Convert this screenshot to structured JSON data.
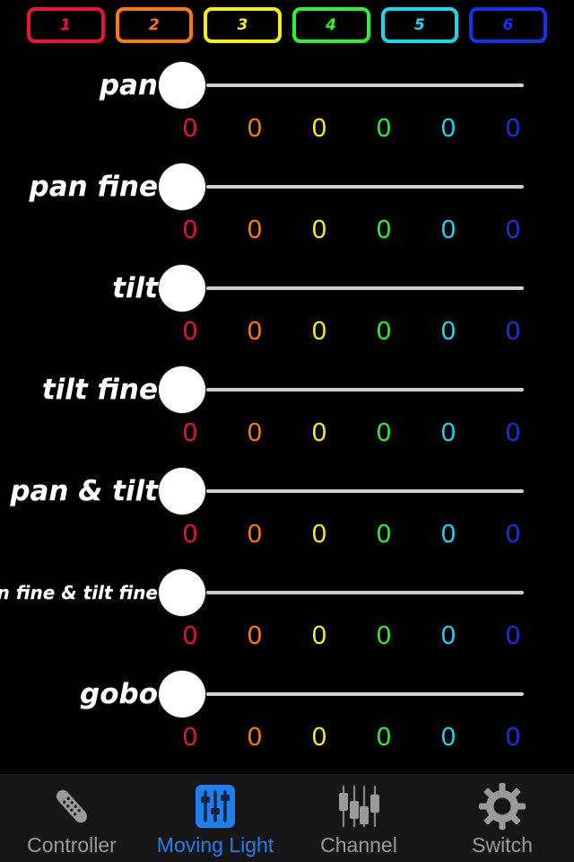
{
  "app": {
    "background": "#000000"
  },
  "channel_bar": {
    "name": "channel-selector",
    "buttons": [
      {
        "label": "1",
        "color": "#ee1133"
      },
      {
        "label": "2",
        "color": "#ff7a00"
      },
      {
        "label": "3",
        "color": "#f8ee14"
      },
      {
        "label": "4",
        "color": "#2bf22b"
      },
      {
        "label": "5",
        "color": "#18d8f0"
      },
      {
        "label": "6",
        "color": "#1432e8"
      }
    ]
  },
  "channel_colors": [
    "#ee1133",
    "#ff7a00",
    "#f8ee14",
    "#2bf22b",
    "#18d8f0",
    "#1432e8"
  ],
  "rows": [
    {
      "label": "pan",
      "label_size": "normal",
      "slider_percent": 0,
      "values": [
        "0",
        "0",
        "0",
        "0",
        "0",
        "0"
      ]
    },
    {
      "label": "pan fine",
      "label_size": "normal",
      "slider_percent": 0,
      "values": [
        "0",
        "0",
        "0",
        "0",
        "0",
        "0"
      ]
    },
    {
      "label": "tilt",
      "label_size": "normal",
      "slider_percent": 0,
      "values": [
        "0",
        "0",
        "0",
        "0",
        "0",
        "0"
      ]
    },
    {
      "label": "tilt fine",
      "label_size": "normal",
      "slider_percent": 0,
      "values": [
        "0",
        "0",
        "0",
        "0",
        "0",
        "0"
      ]
    },
    {
      "label": "pan & tilt",
      "label_size": "normal",
      "slider_percent": 0,
      "values": [
        "0",
        "0",
        "0",
        "0",
        "0",
        "0"
      ]
    },
    {
      "label": "pan fine & tilt fine",
      "label_size": "small",
      "slider_percent": 0,
      "values": [
        "0",
        "0",
        "0",
        "0",
        "0",
        "0"
      ]
    },
    {
      "label": "gobo",
      "label_size": "normal",
      "slider_percent": 0,
      "values": [
        "0",
        "0",
        "0",
        "0",
        "0",
        "0"
      ]
    }
  ],
  "tabbar": {
    "active_color": "#1f7fef",
    "inactive_color": "#9a9a9a",
    "tabs": [
      {
        "label": "Controller",
        "icon": "remote-control-icon",
        "active": false
      },
      {
        "label": "Moving Light",
        "icon": "sliders-square-icon",
        "active": true
      },
      {
        "label": "Channel",
        "icon": "faders-icon",
        "active": false
      },
      {
        "label": "Switch",
        "icon": "gear-icon",
        "active": false
      }
    ]
  }
}
